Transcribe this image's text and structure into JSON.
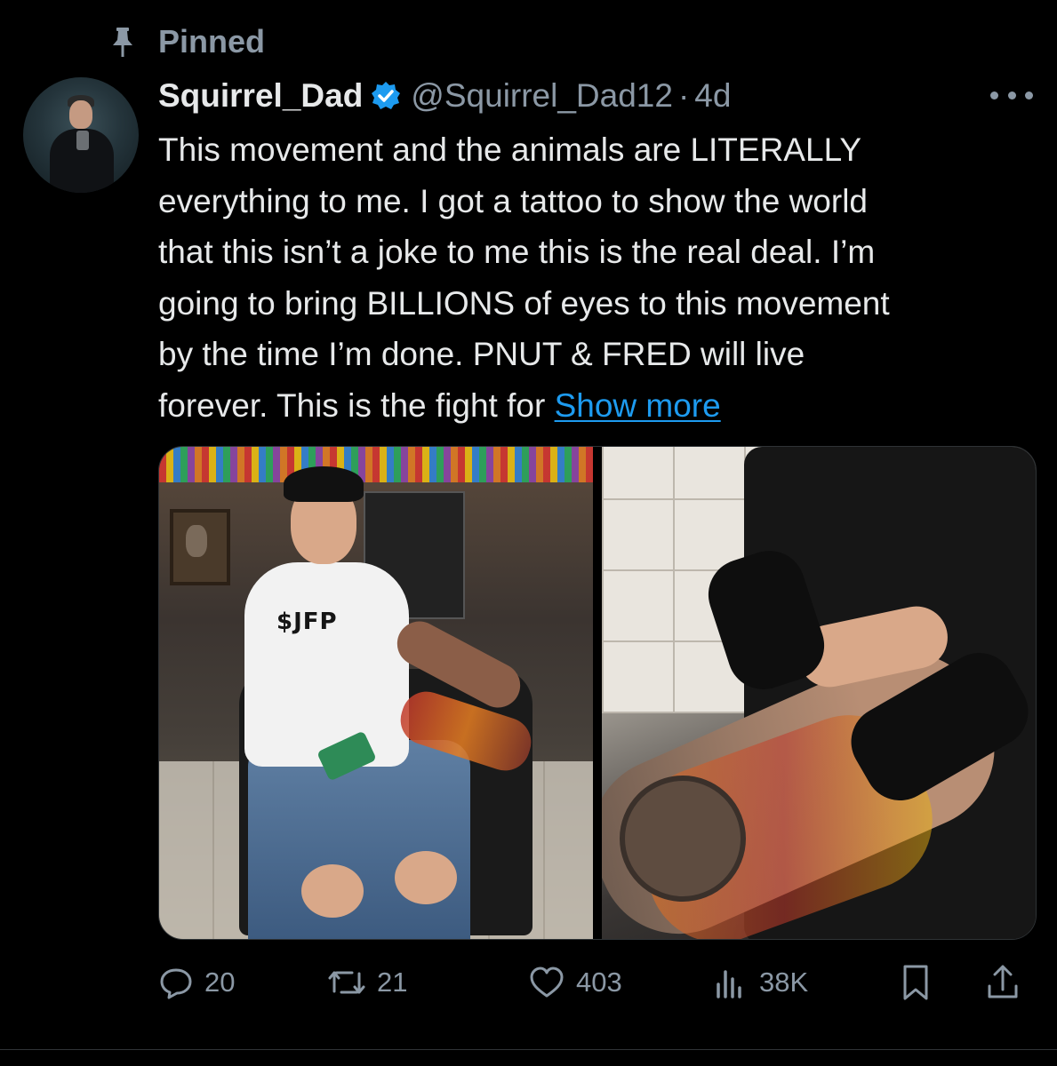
{
  "pinned": {
    "label": "Pinned"
  },
  "author": {
    "display_name": "Squirrel_Dad",
    "handle": "@Squirrel_Dad12",
    "separator": "·",
    "time": "4d"
  },
  "tweet": {
    "lines": [
      "This movement and the animals are LITERALLY",
      "everything to me. I got a tattoo to show the world",
      "that this isn’t a joke to me this is the real deal. I’m",
      "going to bring BILLIONS of eyes to this movement",
      "by the time I’m done. PNUT & FRED will live",
      "forever. This is the fight for "
    ],
    "show_more": "Show more"
  },
  "media": {
    "left_shirt_text": "$JFP"
  },
  "actions": {
    "replies": "20",
    "reposts": "21",
    "likes": "403",
    "views": "38K"
  },
  "colors": {
    "background": "#000000",
    "text": "#e7e9ea",
    "muted": "#8b98a5",
    "link": "#1d9bf0",
    "verified": "#1d9bf0"
  }
}
